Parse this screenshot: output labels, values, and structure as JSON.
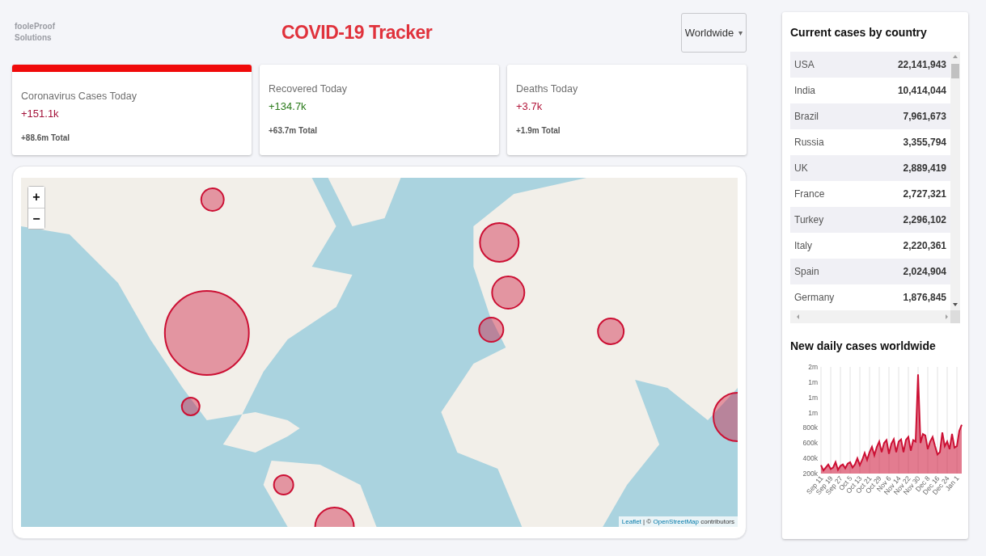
{
  "logo": [
    "fooleProof",
    "Solutions"
  ],
  "title": "COVID-19 Tracker",
  "region_select": {
    "value": "Worldwide",
    "caret": "▾"
  },
  "stats": [
    {
      "kind": "cases",
      "title": "Coronavirus Cases Today",
      "value": "+151.1k",
      "total": "+88.6m Total",
      "selected": true
    },
    {
      "kind": "recovered",
      "title": "Recovered Today",
      "value": "+134.7k",
      "total": "+63.7m Total",
      "selected": false
    },
    {
      "kind": "deaths",
      "title": "Deaths Today",
      "value": "+3.7k",
      "total": "+1.9m Total",
      "selected": false
    }
  ],
  "map": {
    "kind": "picture",
    "zoom_in": "+",
    "zoom_out": "−",
    "attribution": [
      {
        "kind": "link",
        "text": "Leaflet"
      },
      {
        "kind": "text",
        "text": "| ©"
      },
      {
        "kind": "link",
        "text": "OpenStreetMap"
      },
      {
        "kind": "text",
        "text": "contributors"
      }
    ]
  },
  "table": {
    "title": "Current cases by country",
    "rows": [
      {
        "country": "USA",
        "cases": "22,141,943"
      },
      {
        "country": "India",
        "cases": "10,414,044"
      },
      {
        "country": "Brazil",
        "cases": "7,961,673"
      },
      {
        "country": "Russia",
        "cases": "3,355,794"
      },
      {
        "country": "UK",
        "cases": "2,889,419"
      },
      {
        "country": "France",
        "cases": "2,727,321"
      },
      {
        "country": "Turkey",
        "cases": "2,296,102"
      },
      {
        "country": "Italy",
        "cases": "2,220,361"
      },
      {
        "country": "Spain",
        "cases": "2,024,904"
      },
      {
        "country": "Germany",
        "cases": "1,876,845"
      }
    ]
  },
  "daily": {
    "title": "New daily cases worldwide",
    "chart_data": {
      "type": "area",
      "categories": [
        "Sep 11",
        null,
        null,
        null,
        "Sep 19",
        null,
        null,
        null,
        "Sep 27",
        null,
        null,
        null,
        "Oct 5",
        null,
        null,
        null,
        "Oct 13",
        null,
        null,
        null,
        "Oct 21",
        null,
        null,
        null,
        "Oct 29",
        null,
        null,
        null,
        "Nov 6",
        null,
        null,
        null,
        "Nov 14",
        null,
        null,
        null,
        "Nov 22",
        null,
        null,
        null,
        "Nov 30",
        null,
        null,
        null,
        "Dec 8",
        null,
        null,
        null,
        "Dec 16",
        null,
        null,
        null,
        "Dec 24",
        null,
        null,
        null,
        "Jan 1",
        null,
        null
      ],
      "series": [
        {
          "color": "#cc1034",
          "values": [
            310000,
            240000,
            280000,
            320000,
            260000,
            280000,
            350000,
            250000,
            300000,
            320000,
            270000,
            330000,
            350000,
            280000,
            320000,
            400000,
            310000,
            380000,
            470000,
            380000,
            480000,
            550000,
            440000,
            550000,
            620000,
            480000,
            600000,
            640000,
            460000,
            590000,
            650000,
            480000,
            620000,
            650000,
            480000,
            640000,
            680000,
            500000,
            640000,
            620000,
            1500000,
            600000,
            720000,
            700000,
            520000,
            620000,
            680000,
            560000,
            450000,
            480000,
            740000,
            560000,
            620000,
            520000,
            720000,
            540000,
            560000,
            760000,
            840000
          ]
        }
      ],
      "ylim": [
        200000,
        1600000
      ],
      "yticks": [
        {
          "value": 200000,
          "label": "200k"
        },
        {
          "value": 400000,
          "label": "400k"
        },
        {
          "value": 600000,
          "label": "600k"
        },
        {
          "value": 800000,
          "label": "800k"
        },
        {
          "value": 1000000,
          "label": "1m"
        },
        {
          "value": 1200000,
          "label": "1m"
        },
        {
          "value": 1400000,
          "label": "1m"
        },
        {
          "value": 1600000,
          "label": "2m"
        }
      ]
    }
  }
}
